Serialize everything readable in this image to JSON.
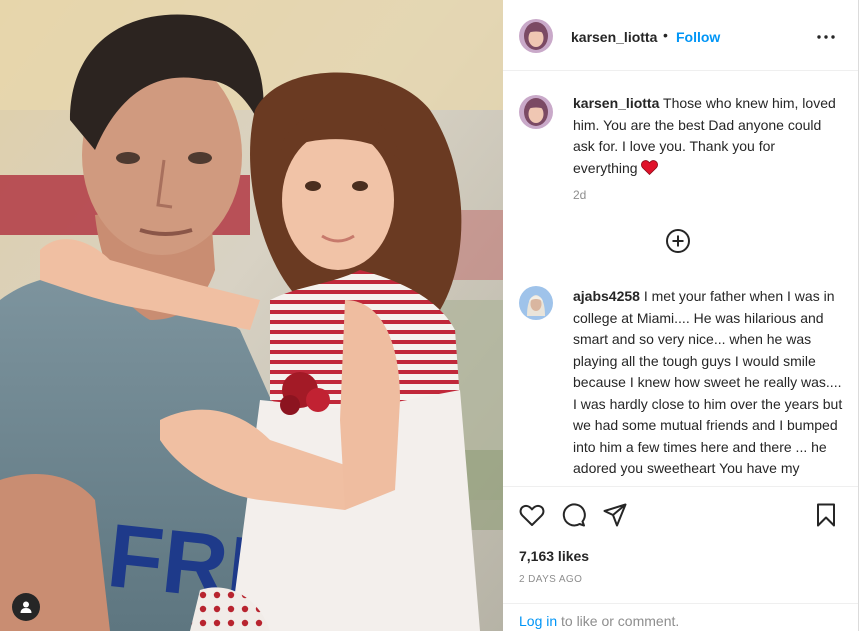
{
  "post": {
    "author": "karsen_liotta",
    "separator": "•",
    "follow_label": "Follow",
    "more_icon": "more-horizontal-icon"
  },
  "comments": [
    {
      "username": "karsen_liotta",
      "text": "Those who knew him, loved him. You are the best Dad anyone could ask for. I love you. Thank you for everything",
      "emoji": "red-heart-icon",
      "time": "2d"
    },
    {
      "username": "ajabs4258",
      "text": "I met your father when I was in college at Miami.... He was hilarious and smart and so very nice... when he was playing all the tough guys I would smile because I knew how sweet he really was.... I was hardly close to him over the years but we had some mutual friends and I bumped into him a few times here and there ... he adored you sweetheart You have my prayers- be kind to yourself"
    }
  ],
  "load_more_icon": "plus-circle-icon",
  "actions": {
    "icons": [
      "heart-icon",
      "comment-icon",
      "share-icon",
      "bookmark-icon"
    ],
    "likes": "7,163 likes",
    "posted": "2 DAYS AGO"
  },
  "login": {
    "link": "Log in",
    "rest": "to like or comment."
  },
  "photo": {
    "shirt_text": "FRE",
    "user_tag_icon": "user-tag-icon"
  }
}
